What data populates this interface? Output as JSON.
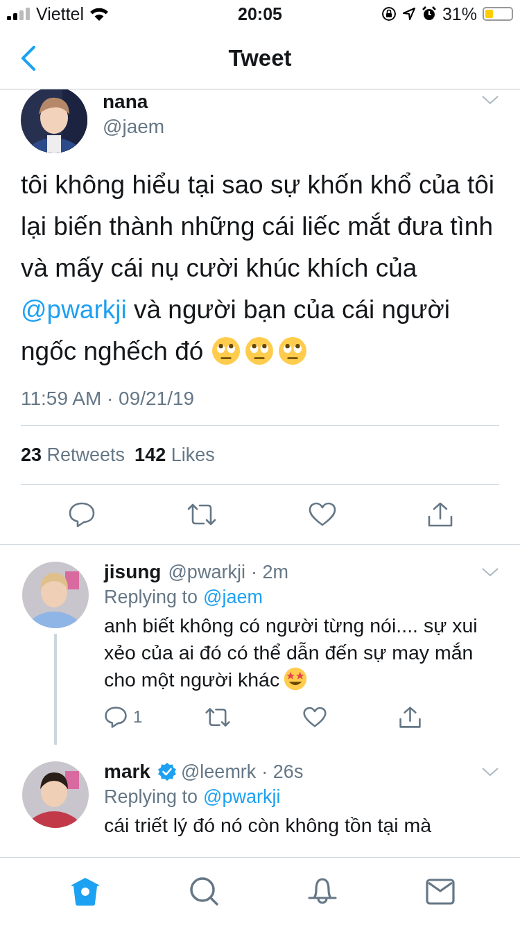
{
  "status_bar": {
    "carrier": "Viettel",
    "time": "20:05",
    "battery": "31%"
  },
  "header": {
    "title": "Tweet"
  },
  "tweet": {
    "name": "nana",
    "handle": "@jaem",
    "text": [
      {
        "kind": "text",
        "text": "tôi không hiểu tại sao sự khốn khổ của tôi lại biến thành những cái liếc mắt đưa tình và mấy cái nụ cười khúc khích của "
      },
      {
        "kind": "mention",
        "text": "@pwarkji"
      },
      {
        "kind": "text",
        "text": " và người bạn của cái người ngốc nghếch đó"
      }
    ],
    "timestamp": "11:59 AM · 09/21/19",
    "stats": [
      {
        "count": "23",
        "label": "Retweets"
      },
      {
        "count": "142",
        "label": "Likes"
      }
    ]
  },
  "replies": [
    {
      "name": "jisung",
      "verified": false,
      "handle": "@pwarkji",
      "time": "· 2m",
      "replying_label": "Replying to",
      "replying_to": "@jaem",
      "text": "anh biết không có người từng nói.... sự xui xẻo của ai đó có thể dẫn đến sự may mắn cho một người khác",
      "reply_count": "1",
      "thread_line": true
    },
    {
      "name": "mark",
      "verified": true,
      "handle": "@leemrk",
      "time": "· 26s",
      "replying_label": "Replying to",
      "replying_to": "@pwarkji",
      "text": "cái triết lý đó nó còn không tồn tại mà",
      "thread_line": false
    }
  ],
  "tab_bar": [
    {
      "kind": "home",
      "selected": true
    },
    {
      "kind": "search",
      "selected": false
    },
    {
      "kind": "notifications",
      "selected": false
    },
    {
      "kind": "messages",
      "selected": false
    }
  ]
}
